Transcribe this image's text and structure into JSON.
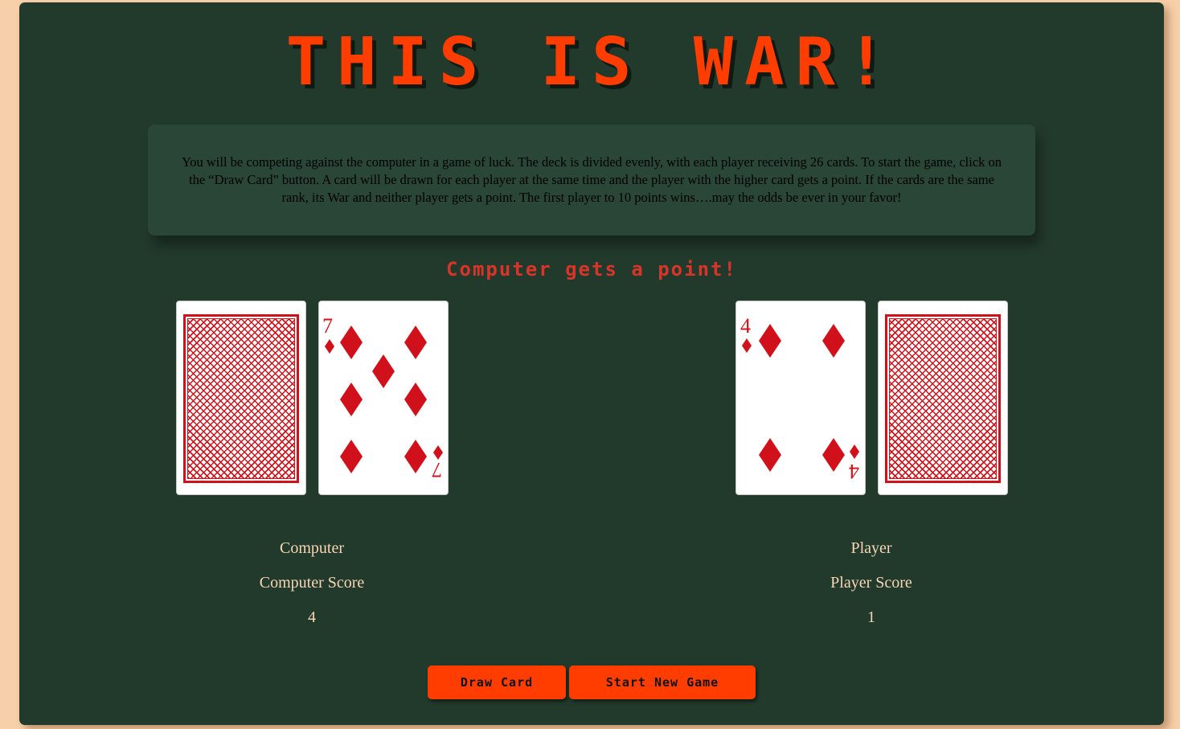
{
  "title": "THIS IS WAR!",
  "rules_text": "You will be competing against the computer in a game of luck. The deck is divided evenly, with each player receiving 26 cards. To start the game, click on the “Draw Card” button. A card will be drawn for each player at the same time and the player with the higher card gets a point. If the cards are the same rank, its War and neither player gets a point. The first player to 10 points wins….may the odds be ever in your favor!",
  "message": "Computer gets a point!",
  "computer": {
    "deck_icon": "card-back",
    "card": {
      "rank": "7",
      "suit": "diamonds",
      "suit_icon": "diamond-icon"
    },
    "name_label": "Computer",
    "score_label": "Computer Score",
    "score": "4"
  },
  "player": {
    "deck_icon": "card-back",
    "card": {
      "rank": "4",
      "suit": "diamonds",
      "suit_icon": "diamond-icon"
    },
    "name_label": "Player",
    "score_label": "Player Score",
    "score": "1"
  },
  "buttons": {
    "draw": "Draw Card",
    "new_game": "Start New Game"
  },
  "colors": {
    "background": "#f7cfa9",
    "panel": "#223a2c",
    "accent": "#ff3d00",
    "card_red": "#d0101a",
    "message": "#d8352a",
    "text": "#f7d6b4"
  }
}
